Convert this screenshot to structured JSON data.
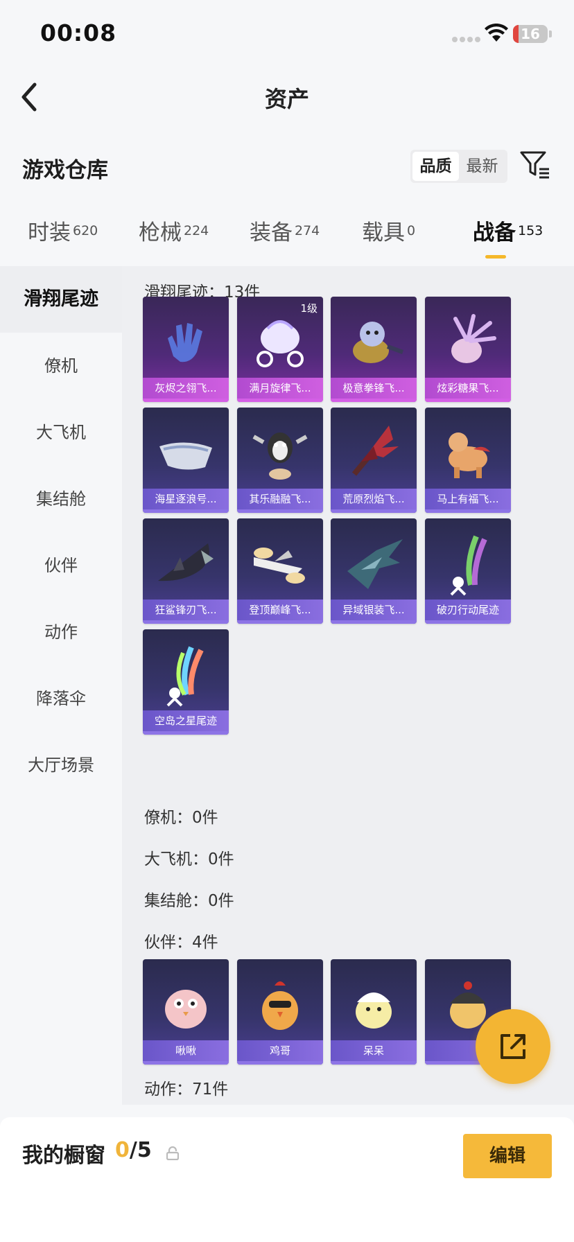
{
  "status_bar": {
    "time": "00:08",
    "battery": "16",
    "battery_level": 0.16
  },
  "nav": {
    "title": "资产"
  },
  "warehouse": {
    "title": "游戏仓库",
    "sort_options": [
      "品质",
      "最新"
    ],
    "active_sort": 0
  },
  "category_tabs": [
    {
      "label": "时装",
      "count": "620"
    },
    {
      "label": "枪械",
      "count": "224"
    },
    {
      "label": "装备",
      "count": "274"
    },
    {
      "label": "载具",
      "count": "0"
    },
    {
      "label": "战备",
      "count": "153",
      "active": true
    }
  ],
  "sidebar": {
    "items": [
      {
        "label": "滑翔尾迹",
        "active": true
      },
      {
        "label": "僚机"
      },
      {
        "label": "大飞机"
      },
      {
        "label": "集结舱"
      },
      {
        "label": "伙伴"
      },
      {
        "label": "动作"
      },
      {
        "label": "降落伞"
      },
      {
        "label": "大厅场景"
      }
    ]
  },
  "sections": {
    "glide_trail": {
      "header": "滑翔尾迹：13件",
      "items": [
        {
          "name": "灰烬之翎飞...",
          "rarity": "gold",
          "icon": "glove-icon"
        },
        {
          "name": "满月旋律飞...",
          "rarity": "gold",
          "icon": "carriage-icon",
          "badge": "1级"
        },
        {
          "name": "极意拳锋飞...",
          "rarity": "gold",
          "icon": "creature-icon"
        },
        {
          "name": "炫彩糖果飞...",
          "rarity": "gold",
          "icon": "candy-icon"
        },
        {
          "name": "海星逐浪号...",
          "rarity": "purple",
          "icon": "boat-icon"
        },
        {
          "name": "其乐融融飞...",
          "rarity": "purple",
          "icon": "penguin-icon"
        },
        {
          "name": "荒原烈焰飞...",
          "rarity": "purple",
          "icon": "flame-wing-icon"
        },
        {
          "name": "马上有福飞...",
          "rarity": "purple",
          "icon": "horse-icon"
        },
        {
          "name": "狂鲨锋刃飞...",
          "rarity": "purple",
          "icon": "shark-icon"
        },
        {
          "name": "登顶巅峰飞...",
          "rarity": "purple",
          "icon": "jet-icon"
        },
        {
          "name": "异域银装飞...",
          "rarity": "purple",
          "icon": "blade-wing-icon"
        },
        {
          "name": "破刃行动尾迹",
          "rarity": "purple",
          "icon": "trail-icon"
        },
        {
          "name": "空岛之星尾迹",
          "rarity": "purple",
          "icon": "rainbow-trail-icon"
        }
      ]
    },
    "wingman": {
      "header": "僚机：0件"
    },
    "big_plane": {
      "header": "大飞机：0件"
    },
    "pod": {
      "header": "集结舱：0件"
    },
    "partner": {
      "header": "伙伴：4件",
      "items": [
        {
          "name": "啾啾",
          "icon": "pink-chick-icon"
        },
        {
          "name": "鸡哥",
          "icon": "rooster-icon"
        },
        {
          "name": "呆呆",
          "icon": "white-chick-icon"
        },
        {
          "name": "",
          "icon": "helmet-chick-icon"
        }
      ]
    },
    "emote": {
      "header": "动作：71件"
    }
  },
  "showcase": {
    "title": "我的橱窗",
    "used": "0",
    "total": "/5",
    "edit_label": "编辑"
  },
  "colors": {
    "accent": "#f5b93a",
    "gold_card": "#7c2fa0",
    "purple_card": "#4b3f93"
  }
}
